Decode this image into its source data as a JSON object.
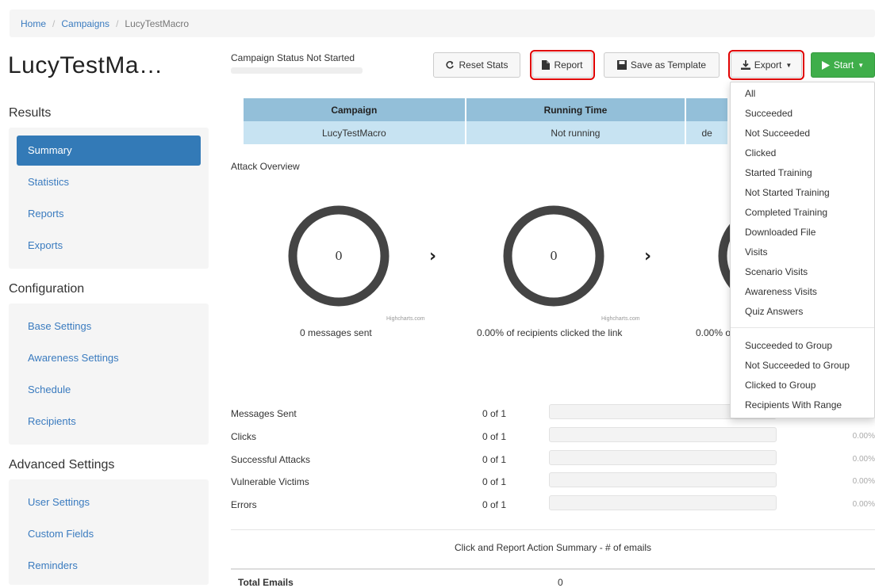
{
  "breadcrumb": {
    "home": "Home",
    "campaigns": "Campaigns",
    "current": "LucyTestMacro",
    "separator": "/"
  },
  "page_title": "LucyTestMa…",
  "sidebar": {
    "sections": [
      {
        "heading": "Results",
        "items": [
          {
            "label": "Summary",
            "active": true
          },
          {
            "label": "Statistics"
          },
          {
            "label": "Reports"
          },
          {
            "label": "Exports"
          }
        ]
      },
      {
        "heading": "Configuration",
        "items": [
          {
            "label": "Base Settings"
          },
          {
            "label": "Awareness Settings"
          },
          {
            "label": "Schedule"
          },
          {
            "label": "Recipients"
          }
        ]
      },
      {
        "heading": "Advanced Settings",
        "items": [
          {
            "label": "User Settings"
          },
          {
            "label": "Custom Fields"
          },
          {
            "label": "Reminders"
          }
        ]
      }
    ]
  },
  "status": {
    "text": "Campaign Status Not Started"
  },
  "toolbar": {
    "reset_label": "Reset Stats",
    "report_label": "Report",
    "template_label": "Save as Template",
    "export_label": "Export",
    "start_label": "Start",
    "icons": {
      "reset": "refresh-icon",
      "report": "file-icon",
      "template": "save-icon",
      "export": "download-icon",
      "start": "play-icon"
    }
  },
  "info_table": {
    "headers": [
      "Campaign",
      "Running Time",
      ""
    ],
    "row": [
      "LucyTestMacro",
      "Not running",
      "de"
    ]
  },
  "attack_overview": {
    "title": "Attack Overview",
    "credit": "Highcharts.com",
    "rings": [
      {
        "value": "0",
        "caption": "0 messages sent"
      },
      {
        "value": "0",
        "caption": "0.00% of recipients clicked the link"
      },
      {
        "value": "",
        "caption": "0.00% o"
      }
    ],
    "ring_color": "#444444",
    "separator_glyph": "›"
  },
  "stats": [
    {
      "label": "Messages Sent",
      "count": "0 of 1",
      "progress": 0,
      "percent": ""
    },
    {
      "label": "Clicks",
      "count": "0 of 1",
      "progress": 0,
      "percent": "0.00%"
    },
    {
      "label": "Successful Attacks",
      "count": "0 of 1",
      "progress": 0,
      "percent": "0.00%"
    },
    {
      "label": "Vulnerable Victims",
      "count": "0 of 1",
      "progress": 0,
      "percent": "0.00%"
    },
    {
      "label": "Errors",
      "count": "0 of 1",
      "progress": 0,
      "percent": "0.00%"
    }
  ],
  "summary": {
    "caption": "Click and Report Action Summary - # of emails",
    "total_label": "Total Emails",
    "total_value": "0"
  },
  "export_menu": {
    "items": [
      "All",
      "Succeeded",
      "Not Succeeded",
      "Clicked",
      "Started Training",
      "Not Started Training",
      "Completed Training",
      "Downloaded File",
      "Visits",
      "Scenario Visits",
      "Awareness Visits",
      "Quiz Answers"
    ],
    "group_items": [
      "Succeeded to Group",
      "Not Succeeded to Group",
      "Clicked to Group",
      "Recipients With Range"
    ]
  },
  "colors": {
    "accent": "#337ab7",
    "success": "#3fae4a",
    "highlight": "#e00000",
    "table_header": "#93bfd9",
    "table_cell": "#c7e3f2"
  }
}
